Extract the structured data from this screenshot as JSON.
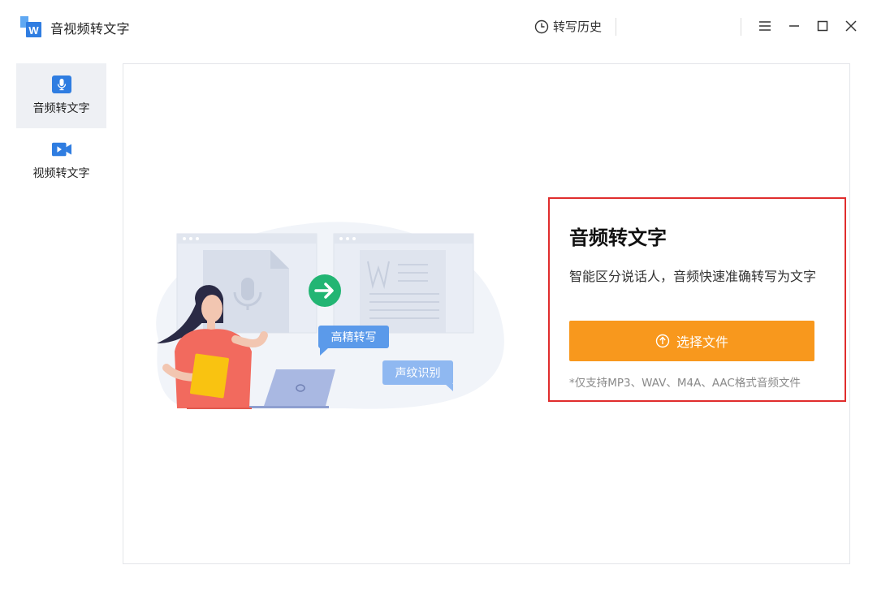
{
  "app": {
    "title": "音视频转文字",
    "logo_icon": "doc-w-icon"
  },
  "header": {
    "history_label": "转写历史",
    "history_icon": "clock-icon",
    "window_controls": [
      "menu-icon",
      "minimize-icon",
      "maximize-icon",
      "close-icon"
    ]
  },
  "sidebar": {
    "items": [
      {
        "label": "音频转文字",
        "icon": "microphone-icon",
        "active": true
      },
      {
        "label": "视频转文字",
        "icon": "video-camera-icon",
        "active": false
      }
    ]
  },
  "illustration": {
    "badge_1": "高精转写",
    "badge_2": "声纹识别"
  },
  "main": {
    "heading": "音频转文字",
    "description": "智能区分说话人，音频快速准确转写为文字",
    "select_button_label": "选择文件",
    "select_button_icon": "upload-shield-icon",
    "support_note": "*仅支持MP3、WAV、M4A、AAC格式音频文件"
  },
  "colors": {
    "accent_blue": "#2f7de1",
    "button_orange": "#f8981d",
    "highlight_red": "#e02d2d",
    "arrow_green": "#22b573"
  }
}
